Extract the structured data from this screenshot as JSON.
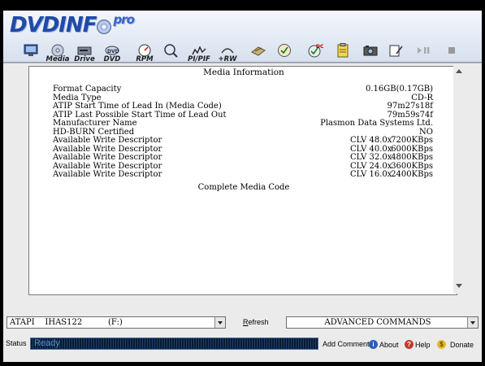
{
  "app": {
    "logo_text": "DVDINF",
    "logo_pro": "pro"
  },
  "toolbar": {
    "items": [
      {
        "name": "monitor",
        "label": "",
        "icon": "monitor-icon"
      },
      {
        "name": "media",
        "label": "Media",
        "icon": "media-icon"
      },
      {
        "name": "drive",
        "label": "Drive",
        "icon": "drive-icon"
      },
      {
        "name": "dvd",
        "label": "DVD",
        "icon": "dvd-icon"
      },
      {
        "name": "rpm",
        "label": "RPM",
        "icon": "rpm-icon"
      },
      {
        "name": "search",
        "label": "",
        "icon": "magnifier-icon"
      },
      {
        "name": "pipif",
        "label": "PI/PIF",
        "icon": "pipif-icon"
      },
      {
        "name": "rw",
        "label": "+RW",
        "icon": "rw-icon"
      },
      {
        "name": "disc-write",
        "label": "",
        "icon": "disc-write-icon"
      },
      {
        "name": "disc-scan",
        "label": "",
        "icon": "disc-scan-icon"
      },
      {
        "name": "disc-burn",
        "label": "",
        "icon": "disc-burn-icon"
      },
      {
        "name": "clipboard",
        "label": "",
        "icon": "clipboard-icon"
      },
      {
        "name": "camera",
        "label": "",
        "icon": "camera-icon"
      },
      {
        "name": "edit",
        "label": "",
        "icon": "edit-icon"
      },
      {
        "name": "pause",
        "label": "",
        "icon": "pause-icon"
      },
      {
        "name": "stop",
        "label": "",
        "icon": "stop-icon"
      }
    ]
  },
  "media_info": {
    "title": "Media Information",
    "rows": [
      {
        "label": "Format Capacity",
        "value": "0.16GB(0.17GB)"
      },
      {
        "label": "Media Type",
        "value": "CD-R"
      },
      {
        "label": "ATIP Start Time of Lead In (Media Code)",
        "value": "97m27s18f"
      },
      {
        "label": "ATIP Last Possible Start Time of Lead Out",
        "value": "79m59s74f"
      },
      {
        "label": "Manufacturer Name",
        "value": "Plasmon Data Systems Ltd."
      },
      {
        "label": "HD-BURN Certified",
        "value": "NO"
      }
    ],
    "write_descriptors": [
      {
        "label": "Available Write Descriptor",
        "speed": "CLV 48.0x",
        "kbps": "7200KBps"
      },
      {
        "label": "Available Write Descriptor",
        "speed": "CLV 40.0x",
        "kbps": "6000KBps"
      },
      {
        "label": "Available Write Descriptor",
        "speed": "CLV 32.0x",
        "kbps": "4800KBps"
      },
      {
        "label": "Available Write Descriptor",
        "speed": "CLV 24.0x",
        "kbps": "3600KBps"
      },
      {
        "label": "Available Write Descriptor",
        "speed": "CLV 16.0x",
        "kbps": "2400KBps"
      }
    ],
    "complete_code_label": "Complete Media Code"
  },
  "bottom": {
    "drive_select": "ATAPI    IHAS122          (F:)",
    "refresh_label_u": "R",
    "refresh_label_rest": "efresh",
    "commands_select": "ADVANCED COMMANDS",
    "status_label": "Status",
    "status_text": "Ready",
    "add_comment": "Add Comment",
    "about": "About",
    "help": "Help",
    "donate": "Donate"
  }
}
